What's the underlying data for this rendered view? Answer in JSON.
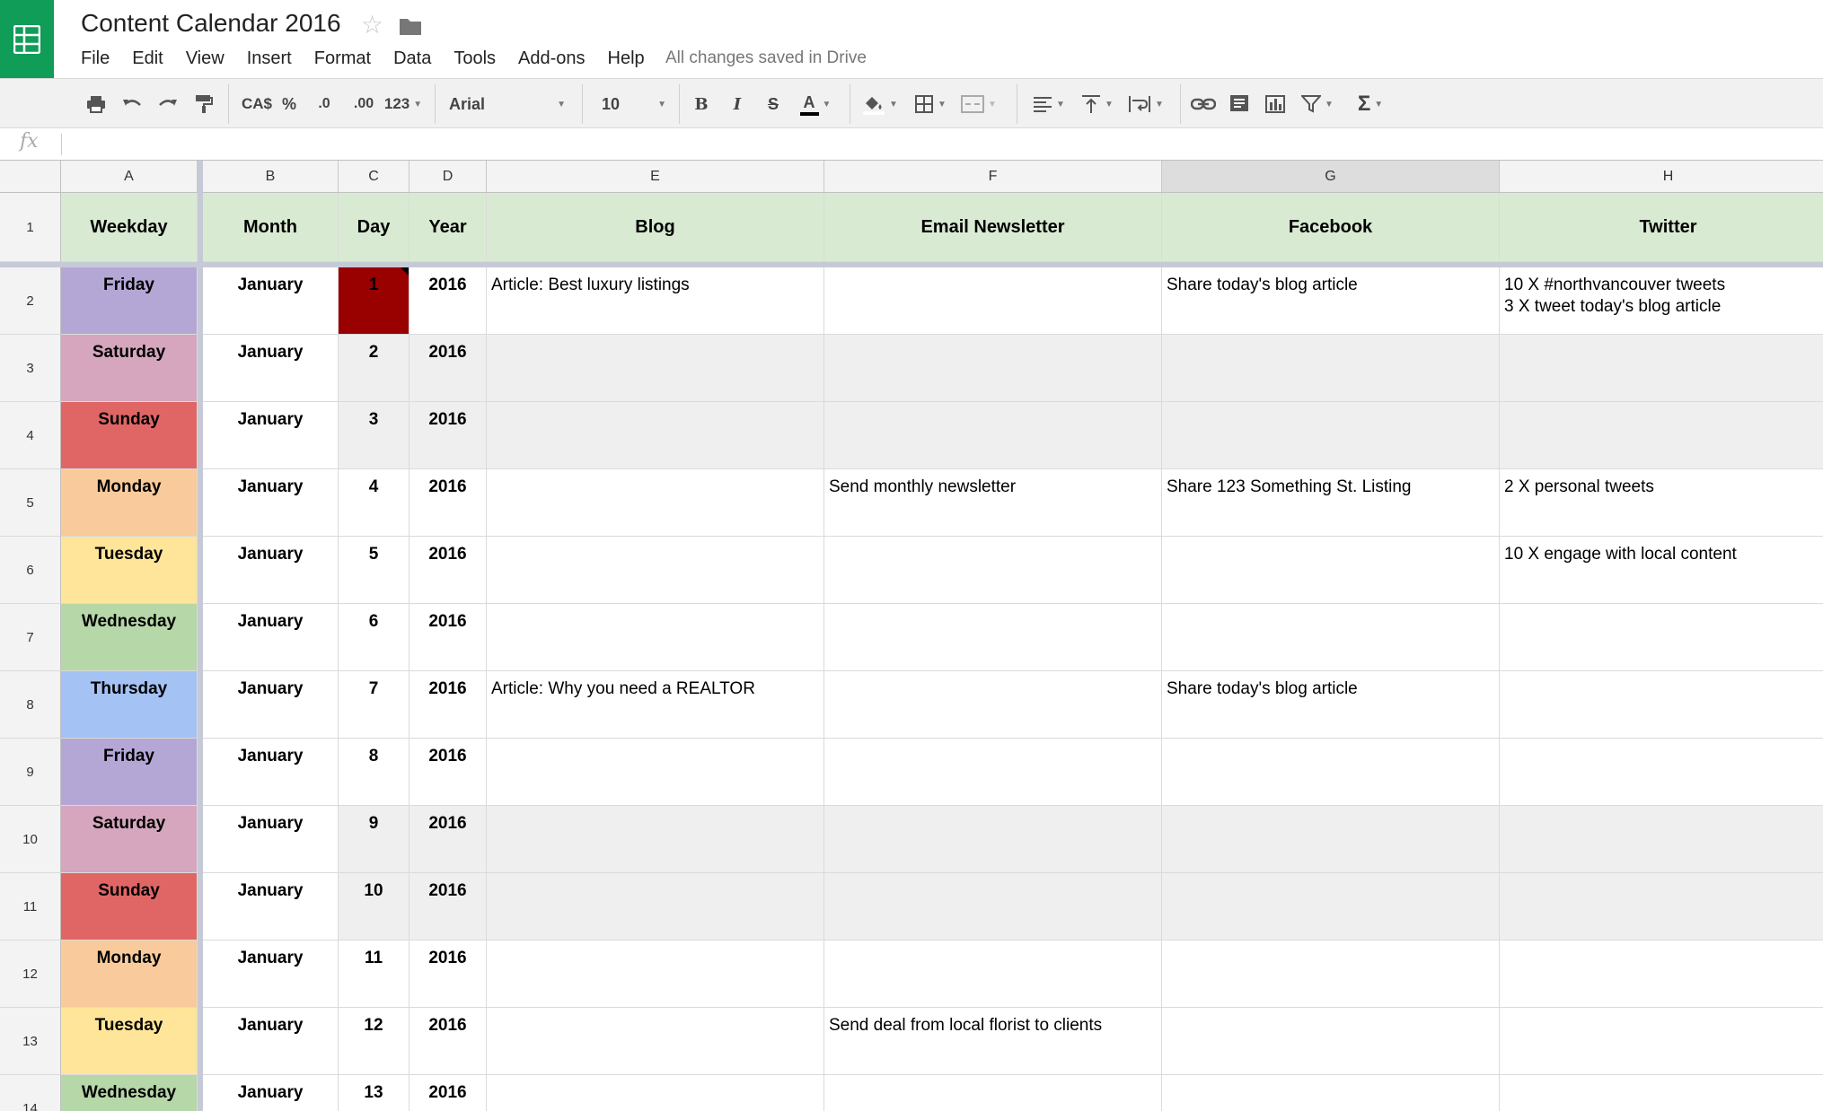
{
  "app": {
    "title": "Content Calendar 2016",
    "save_status": "All changes saved in Drive",
    "brand_color": "#0f9d58"
  },
  "menu": [
    "File",
    "Edit",
    "View",
    "Insert",
    "Format",
    "Data",
    "Tools",
    "Add-ons",
    "Help"
  ],
  "toolbar": {
    "currency": "CA$",
    "percent": "%",
    "decrease_decimals": ".0",
    "increase_decimals": ".00",
    "more_formats": "123",
    "font": "Arial",
    "font_size": "10",
    "bold": "B",
    "italic": "I",
    "strikethrough": "S",
    "text_color": "A",
    "functions": "Σ"
  },
  "formula_bar": {
    "icon": "fx",
    "value": ""
  },
  "sheet": {
    "columns": [
      "A",
      "B",
      "C",
      "D",
      "E",
      "F",
      "G",
      "H"
    ],
    "selected_column": "G",
    "header_row": {
      "number": "1",
      "cells": [
        "Weekday",
        "Month",
        "Day",
        "Year",
        "Blog",
        "Email Newsletter",
        "Facebook",
        "Twitter"
      ],
      "fill": "#d9ead3"
    },
    "weekday_colors": {
      "Friday": "#b4a7d6",
      "Saturday": "#d5a6bd",
      "Sunday": "#e06666",
      "Monday": "#f9cb9c",
      "Tuesday": "#ffe599",
      "Wednesday": "#b6d7a8",
      "Thursday": "#a4c2f4"
    },
    "highlight_fill": "#990000",
    "rows": [
      {
        "n": "2",
        "weekday": "Friday",
        "month": "January",
        "day": "1",
        "year": "2016",
        "blog": "Article: Best luxury listings",
        "email": "",
        "facebook": "Share today's blog article",
        "twitter": "10 X #northvancouver tweets\n3 X tweet today's blog article",
        "shade": false
      },
      {
        "n": "3",
        "weekday": "Saturday",
        "month": "January",
        "day": "2",
        "year": "2016",
        "blog": "",
        "email": "",
        "facebook": "",
        "twitter": "",
        "shade": true
      },
      {
        "n": "4",
        "weekday": "Sunday",
        "month": "January",
        "day": "3",
        "year": "2016",
        "blog": "",
        "email": "",
        "facebook": "",
        "twitter": "",
        "shade": true
      },
      {
        "n": "5",
        "weekday": "Monday",
        "month": "January",
        "day": "4",
        "year": "2016",
        "blog": "",
        "email": "Send monthly newsletter",
        "facebook": "Share 123 Something St. Listing",
        "twitter": "2 X personal tweets",
        "shade": false
      },
      {
        "n": "6",
        "weekday": "Tuesday",
        "month": "January",
        "day": "5",
        "year": "2016",
        "blog": "",
        "email": "",
        "facebook": "",
        "twitter": "10 X engage with local content",
        "shade": false
      },
      {
        "n": "7",
        "weekday": "Wednesday",
        "month": "January",
        "day": "6",
        "year": "2016",
        "blog": "",
        "email": "",
        "facebook": "",
        "twitter": "",
        "shade": false
      },
      {
        "n": "8",
        "weekday": "Thursday",
        "month": "January",
        "day": "7",
        "year": "2016",
        "blog": "Article: Why you need a REALTOR",
        "email": "",
        "facebook": "Share today's blog article",
        "twitter": "",
        "shade": false
      },
      {
        "n": "9",
        "weekday": "Friday",
        "month": "January",
        "day": "8",
        "year": "2016",
        "blog": "",
        "email": "",
        "facebook": "",
        "twitter": "",
        "shade": false
      },
      {
        "n": "10",
        "weekday": "Saturday",
        "month": "January",
        "day": "9",
        "year": "2016",
        "blog": "",
        "email": "",
        "facebook": "",
        "twitter": "",
        "shade": true
      },
      {
        "n": "11",
        "weekday": "Sunday",
        "month": "January",
        "day": "10",
        "year": "2016",
        "blog": "",
        "email": "",
        "facebook": "",
        "twitter": "",
        "shade": true
      },
      {
        "n": "12",
        "weekday": "Monday",
        "month": "January",
        "day": "11",
        "year": "2016",
        "blog": "",
        "email": "",
        "facebook": "",
        "twitter": "",
        "shade": false
      },
      {
        "n": "13",
        "weekday": "Tuesday",
        "month": "January",
        "day": "12",
        "year": "2016",
        "blog": "",
        "email": "Send deal from local florist to clients",
        "facebook": "",
        "twitter": "",
        "shade": false
      },
      {
        "n": "14",
        "weekday": "Wednesday",
        "month": "January",
        "day": "13",
        "year": "2016",
        "blog": "",
        "email": "",
        "facebook": "",
        "twitter": "",
        "shade": false
      }
    ]
  }
}
